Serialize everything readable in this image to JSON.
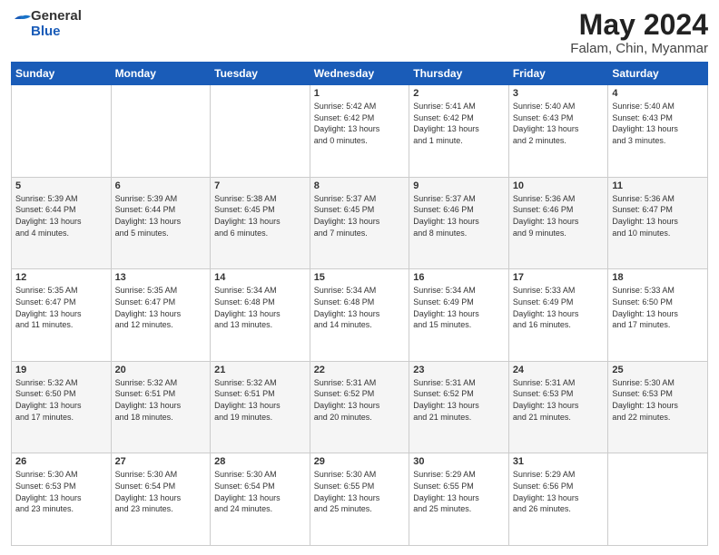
{
  "logo": {
    "general": "General",
    "blue": "Blue"
  },
  "title": "May 2024",
  "location": "Falam, Chin, Myanmar",
  "days_of_week": [
    "Sunday",
    "Monday",
    "Tuesday",
    "Wednesday",
    "Thursday",
    "Friday",
    "Saturday"
  ],
  "weeks": [
    [
      {
        "day": "",
        "info": ""
      },
      {
        "day": "",
        "info": ""
      },
      {
        "day": "",
        "info": ""
      },
      {
        "day": "1",
        "info": "Sunrise: 5:42 AM\nSunset: 6:42 PM\nDaylight: 13 hours\nand 0 minutes."
      },
      {
        "day": "2",
        "info": "Sunrise: 5:41 AM\nSunset: 6:42 PM\nDaylight: 13 hours\nand 1 minute."
      },
      {
        "day": "3",
        "info": "Sunrise: 5:40 AM\nSunset: 6:43 PM\nDaylight: 13 hours\nand 2 minutes."
      },
      {
        "day": "4",
        "info": "Sunrise: 5:40 AM\nSunset: 6:43 PM\nDaylight: 13 hours\nand 3 minutes."
      }
    ],
    [
      {
        "day": "5",
        "info": "Sunrise: 5:39 AM\nSunset: 6:44 PM\nDaylight: 13 hours\nand 4 minutes."
      },
      {
        "day": "6",
        "info": "Sunrise: 5:39 AM\nSunset: 6:44 PM\nDaylight: 13 hours\nand 5 minutes."
      },
      {
        "day": "7",
        "info": "Sunrise: 5:38 AM\nSunset: 6:45 PM\nDaylight: 13 hours\nand 6 minutes."
      },
      {
        "day": "8",
        "info": "Sunrise: 5:37 AM\nSunset: 6:45 PM\nDaylight: 13 hours\nand 7 minutes."
      },
      {
        "day": "9",
        "info": "Sunrise: 5:37 AM\nSunset: 6:46 PM\nDaylight: 13 hours\nand 8 minutes."
      },
      {
        "day": "10",
        "info": "Sunrise: 5:36 AM\nSunset: 6:46 PM\nDaylight: 13 hours\nand 9 minutes."
      },
      {
        "day": "11",
        "info": "Sunrise: 5:36 AM\nSunset: 6:47 PM\nDaylight: 13 hours\nand 10 minutes."
      }
    ],
    [
      {
        "day": "12",
        "info": "Sunrise: 5:35 AM\nSunset: 6:47 PM\nDaylight: 13 hours\nand 11 minutes."
      },
      {
        "day": "13",
        "info": "Sunrise: 5:35 AM\nSunset: 6:47 PM\nDaylight: 13 hours\nand 12 minutes."
      },
      {
        "day": "14",
        "info": "Sunrise: 5:34 AM\nSunset: 6:48 PM\nDaylight: 13 hours\nand 13 minutes."
      },
      {
        "day": "15",
        "info": "Sunrise: 5:34 AM\nSunset: 6:48 PM\nDaylight: 13 hours\nand 14 minutes."
      },
      {
        "day": "16",
        "info": "Sunrise: 5:34 AM\nSunset: 6:49 PM\nDaylight: 13 hours\nand 15 minutes."
      },
      {
        "day": "17",
        "info": "Sunrise: 5:33 AM\nSunset: 6:49 PM\nDaylight: 13 hours\nand 16 minutes."
      },
      {
        "day": "18",
        "info": "Sunrise: 5:33 AM\nSunset: 6:50 PM\nDaylight: 13 hours\nand 17 minutes."
      }
    ],
    [
      {
        "day": "19",
        "info": "Sunrise: 5:32 AM\nSunset: 6:50 PM\nDaylight: 13 hours\nand 17 minutes."
      },
      {
        "day": "20",
        "info": "Sunrise: 5:32 AM\nSunset: 6:51 PM\nDaylight: 13 hours\nand 18 minutes."
      },
      {
        "day": "21",
        "info": "Sunrise: 5:32 AM\nSunset: 6:51 PM\nDaylight: 13 hours\nand 19 minutes."
      },
      {
        "day": "22",
        "info": "Sunrise: 5:31 AM\nSunset: 6:52 PM\nDaylight: 13 hours\nand 20 minutes."
      },
      {
        "day": "23",
        "info": "Sunrise: 5:31 AM\nSunset: 6:52 PM\nDaylight: 13 hours\nand 21 minutes."
      },
      {
        "day": "24",
        "info": "Sunrise: 5:31 AM\nSunset: 6:53 PM\nDaylight: 13 hours\nand 21 minutes."
      },
      {
        "day": "25",
        "info": "Sunrise: 5:30 AM\nSunset: 6:53 PM\nDaylight: 13 hours\nand 22 minutes."
      }
    ],
    [
      {
        "day": "26",
        "info": "Sunrise: 5:30 AM\nSunset: 6:53 PM\nDaylight: 13 hours\nand 23 minutes."
      },
      {
        "day": "27",
        "info": "Sunrise: 5:30 AM\nSunset: 6:54 PM\nDaylight: 13 hours\nand 23 minutes."
      },
      {
        "day": "28",
        "info": "Sunrise: 5:30 AM\nSunset: 6:54 PM\nDaylight: 13 hours\nand 24 minutes."
      },
      {
        "day": "29",
        "info": "Sunrise: 5:30 AM\nSunset: 6:55 PM\nDaylight: 13 hours\nand 25 minutes."
      },
      {
        "day": "30",
        "info": "Sunrise: 5:29 AM\nSunset: 6:55 PM\nDaylight: 13 hours\nand 25 minutes."
      },
      {
        "day": "31",
        "info": "Sunrise: 5:29 AM\nSunset: 6:56 PM\nDaylight: 13 hours\nand 26 minutes."
      },
      {
        "day": "",
        "info": ""
      }
    ]
  ]
}
